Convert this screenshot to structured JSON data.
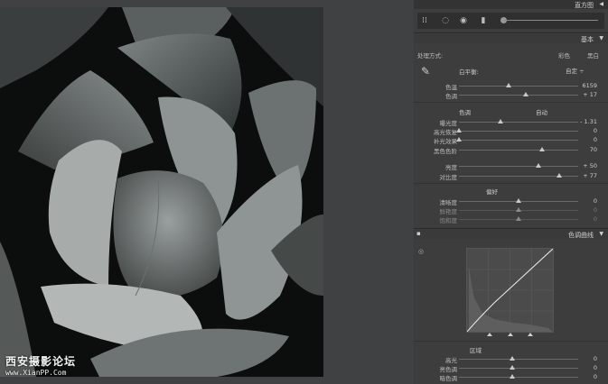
{
  "watermark": {
    "title": "西安摄影论坛",
    "url": "www.XianPP.Com"
  },
  "histogram": {
    "title": "直方图"
  },
  "basic": {
    "title": "基本",
    "treatment_label": "处理方式:",
    "color_option": "彩色",
    "bw_option": "黑白",
    "wb_label": "白平衡:",
    "wb_value": "自定 ÷",
    "temp": {
      "label": "色温",
      "value": "6159",
      "pos": 0.42
    },
    "tint": {
      "label": "色调",
      "value": "+ 17",
      "pos": 0.56
    },
    "tone_label": "色调",
    "auto_label": "自动",
    "exposure": {
      "label": "曝光度",
      "value": "- 1.31",
      "pos": 0.35
    },
    "recovery": {
      "label": "高光恢复",
      "value": "0",
      "pos": 0.0
    },
    "fill": {
      "label": "补光效果",
      "value": "0",
      "pos": 0.0
    },
    "blacks": {
      "label": "黑色色阶",
      "value": "70",
      "pos": 0.7
    },
    "brightness": {
      "label": "亮度",
      "value": "+ 50",
      "pos": 0.67
    },
    "contrast": {
      "label": "对比度",
      "value": "+ 77",
      "pos": 0.84
    },
    "presence_label": "偏好",
    "clarity": {
      "label": "清晰度",
      "value": "0",
      "pos": 0.5
    },
    "vibrance": {
      "label": "鲜艳度",
      "value": "0",
      "pos": 0.5
    },
    "saturation": {
      "label": "饱和度",
      "value": "0",
      "pos": 0.5
    }
  },
  "tone_curve": {
    "title": "色调曲线",
    "region_label": "区域",
    "highlights": {
      "label": "高光",
      "value": "0",
      "pos": 0.45
    },
    "lights": {
      "label": "亮色调",
      "value": "0",
      "pos": 0.45
    },
    "darks": {
      "label": "暗色调",
      "value": "0",
      "pos": 0.45
    }
  },
  "colors": {
    "accent": "#c8c8c8",
    "panel": "#3d3d3d",
    "header": "#333333"
  }
}
